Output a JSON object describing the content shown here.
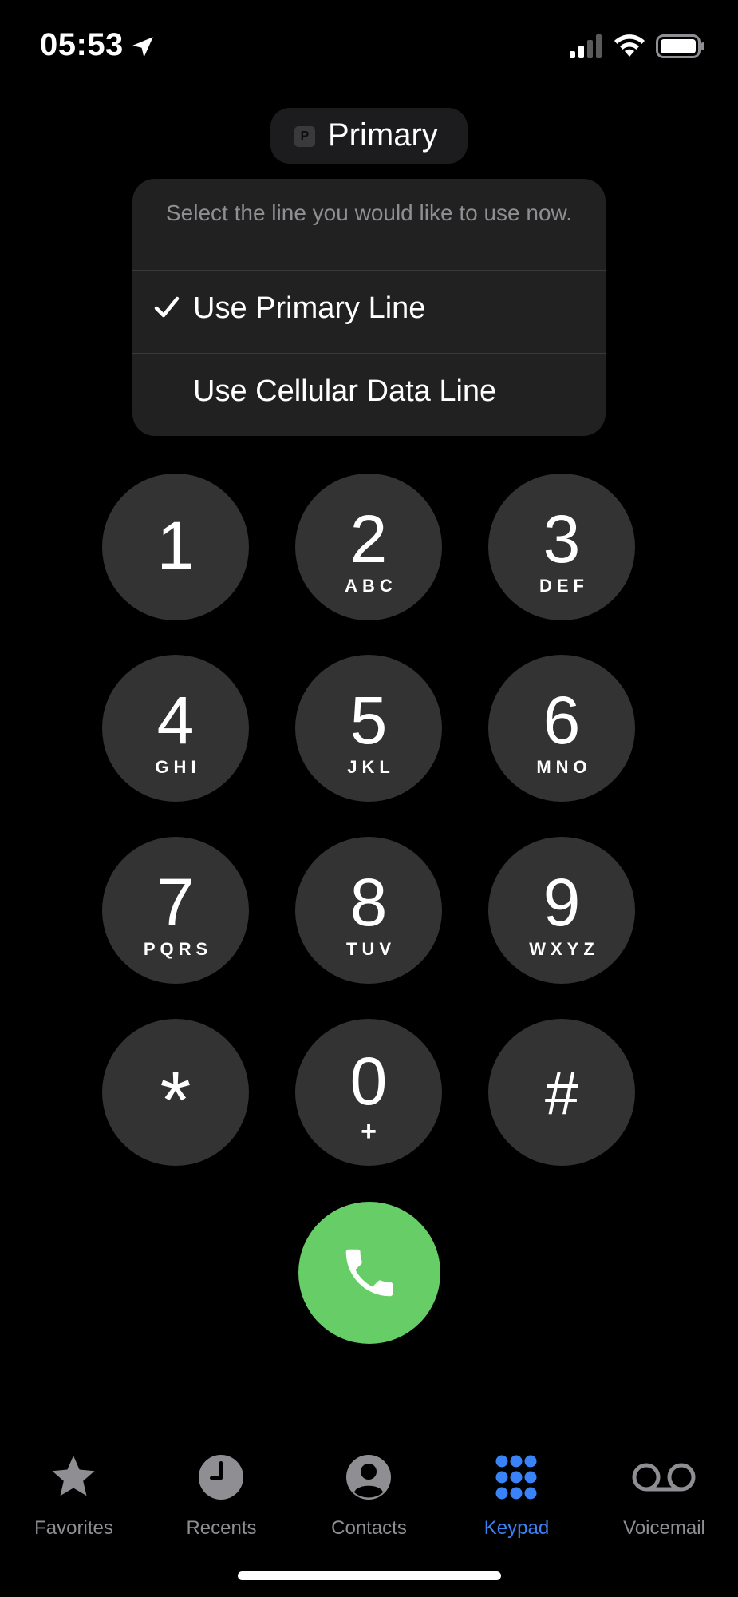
{
  "status_bar": {
    "time": "05:53",
    "icons": [
      "location-arrow-icon",
      "cellular-signal-icon",
      "wifi-icon",
      "battery-icon"
    ]
  },
  "line_selector": {
    "badge": "P",
    "label": "Primary"
  },
  "line_menu": {
    "prompt": "Select the line you would like to use now.",
    "items": [
      {
        "label": "Use Primary Line",
        "checked": true
      },
      {
        "label": "Use Cellular Data Line",
        "checked": false
      }
    ]
  },
  "keypad": {
    "keys": [
      {
        "digit": "1",
        "letters": ""
      },
      {
        "digit": "2",
        "letters": "ABC"
      },
      {
        "digit": "3",
        "letters": "DEF"
      },
      {
        "digit": "4",
        "letters": "GHI"
      },
      {
        "digit": "5",
        "letters": "JKL"
      },
      {
        "digit": "6",
        "letters": "MNO"
      },
      {
        "digit": "7",
        "letters": "PQRS"
      },
      {
        "digit": "8",
        "letters": "TUV"
      },
      {
        "digit": "9",
        "letters": "WXYZ"
      },
      {
        "digit": "*",
        "letters": ""
      },
      {
        "digit": "0",
        "letters": "+"
      },
      {
        "digit": "#",
        "letters": ""
      }
    ],
    "call_icon": "phone-icon"
  },
  "tab_bar": {
    "tabs": [
      {
        "label": "Favorites",
        "icon": "star-icon",
        "active": false
      },
      {
        "label": "Recents",
        "icon": "clock-icon",
        "active": false
      },
      {
        "label": "Contacts",
        "icon": "person-circle-icon",
        "active": false
      },
      {
        "label": "Keypad",
        "icon": "keypad-icon",
        "active": true
      },
      {
        "label": "Voicemail",
        "icon": "voicemail-icon",
        "active": false
      }
    ]
  },
  "colors": {
    "background": "#000000",
    "key": "#333333",
    "call_green": "#67ce67",
    "active_tab": "#3a82f7",
    "inactive_tab": "#8e8e93",
    "menu_background": "#212121"
  }
}
